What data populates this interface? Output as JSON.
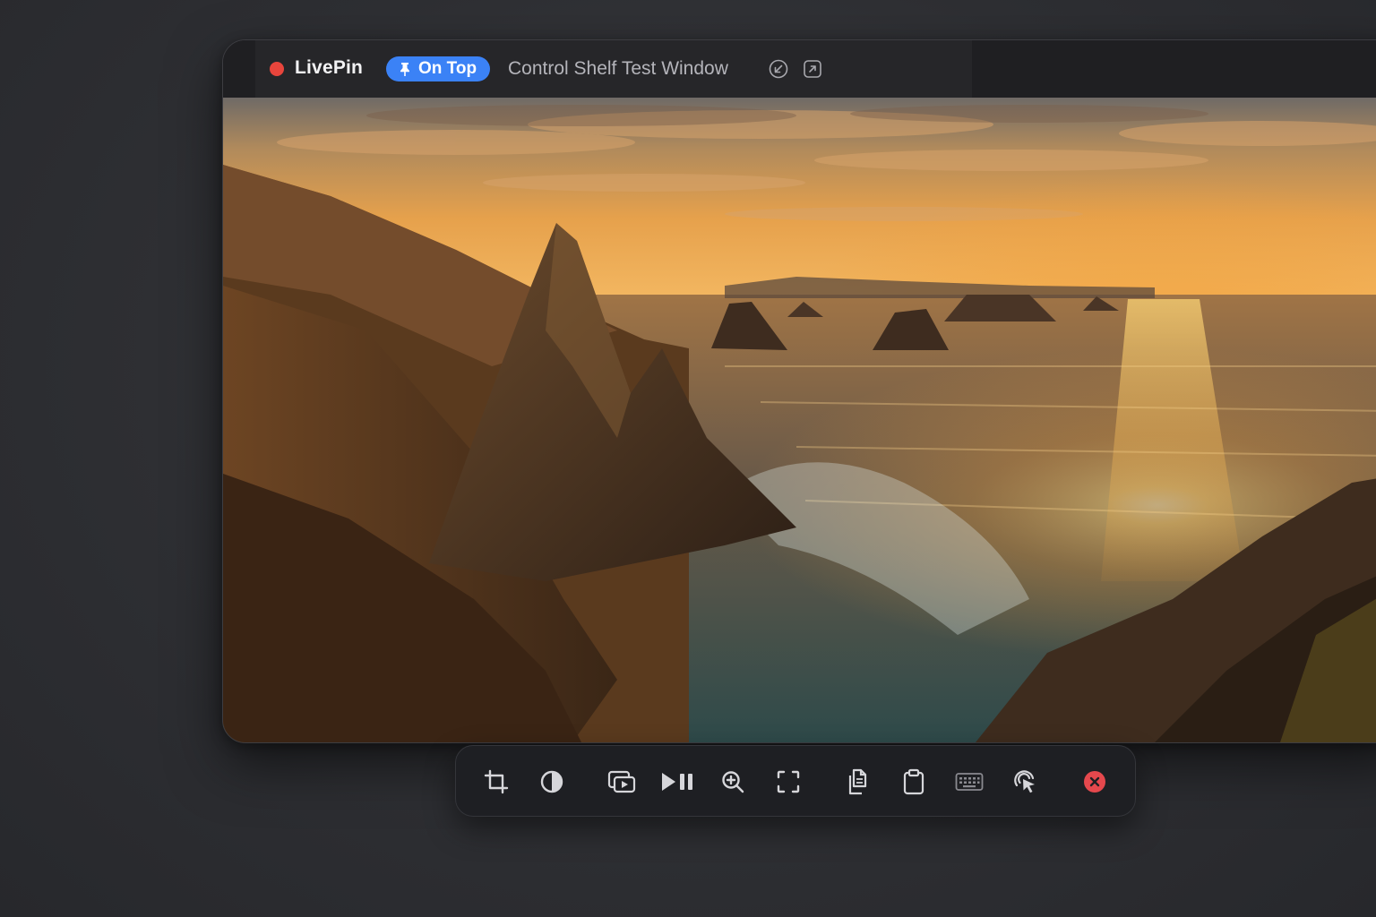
{
  "app": {
    "name": "LivePin",
    "badge_label": "On Top",
    "window_title": "Control Shelf Test Window",
    "status_dot_color": "#e8453c",
    "badge_color": "#3b82f6"
  },
  "titlebar_icons": [
    {
      "name": "restore-icon",
      "icon": "circle-arrow-down-left"
    },
    {
      "name": "open-external-icon",
      "icon": "square-arrow-up-right"
    }
  ],
  "content": {
    "image": "sunset over rocky sea stacks and ocean coastline"
  },
  "control_shelf": {
    "tools": [
      {
        "name": "crop-button",
        "icon": "crop-icon"
      },
      {
        "name": "contrast-button",
        "icon": "contrast-icon"
      },
      {
        "name": "picture-in-picture-button",
        "icon": "pip-play-icon"
      },
      {
        "name": "play-pause-button",
        "icon": "play-pause-icon"
      },
      {
        "name": "zoom-in-button",
        "icon": "zoom-in-icon"
      },
      {
        "name": "fit-to-frame-button",
        "icon": "frame-corners-icon"
      },
      {
        "name": "copy-button",
        "icon": "copy-icon"
      },
      {
        "name": "paste-button",
        "icon": "clipboard-icon"
      },
      {
        "name": "keyboard-button",
        "icon": "keyboard-icon"
      },
      {
        "name": "click-through-button",
        "icon": "cursor-tap-icon"
      },
      {
        "name": "close-button",
        "icon": "close-circle-icon",
        "color": "#e5484d"
      }
    ]
  }
}
